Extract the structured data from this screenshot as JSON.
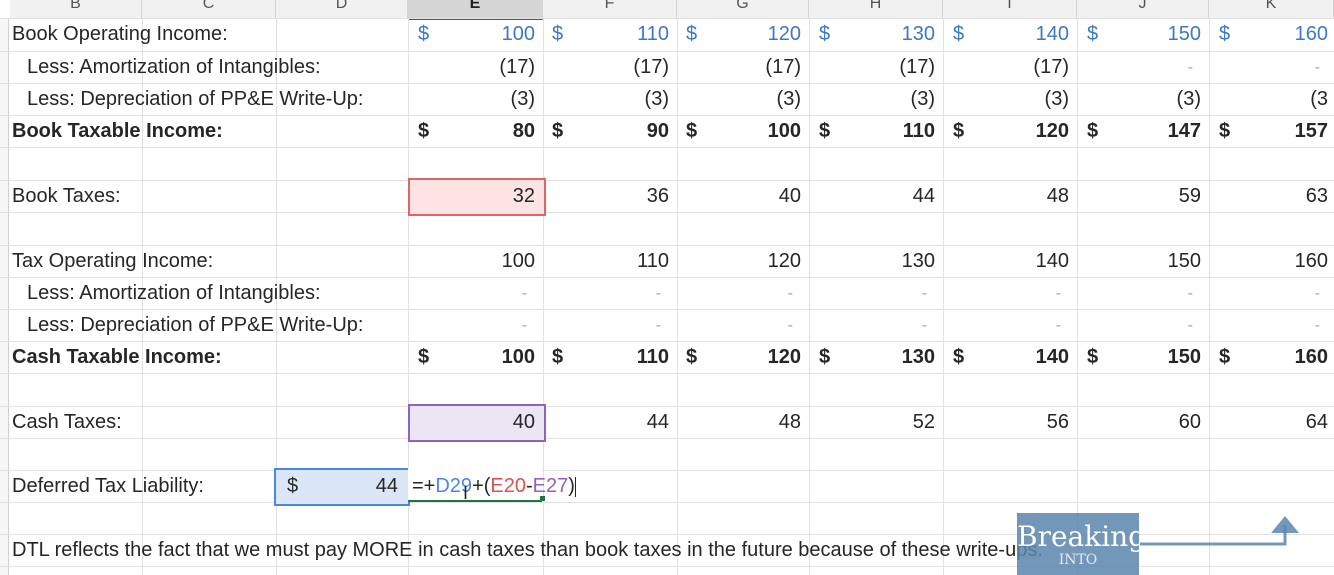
{
  "columns": [
    "B",
    "C",
    "D",
    "E",
    "F",
    "G",
    "H",
    "I",
    "J",
    "K"
  ],
  "selected_column": "E",
  "book_operating_income": {
    "label": "Book Operating Income:",
    "values": [
      "100",
      "110",
      "120",
      "130",
      "140",
      "150",
      "160"
    ]
  },
  "less_amort_1": {
    "label": "Less: Amortization of Intangibles:",
    "values": [
      "(17)",
      "(17)",
      "(17)",
      "(17)",
      "(17)",
      "-",
      "-"
    ]
  },
  "less_dep_1": {
    "label": "Less: Depreciation of PP&E Write-Up:",
    "values": [
      "(3)",
      "(3)",
      "(3)",
      "(3)",
      "(3)",
      "(3)",
      "(3"
    ]
  },
  "book_taxable_income": {
    "label": "Book Taxable Income:",
    "values": [
      "80",
      "90",
      "100",
      "110",
      "120",
      "147",
      "157"
    ]
  },
  "book_taxes": {
    "label": "Book Taxes:",
    "values": [
      "32",
      "36",
      "40",
      "44",
      "48",
      "59",
      "63"
    ]
  },
  "tax_operating_income": {
    "label": "Tax Operating Income:",
    "values": [
      "100",
      "110",
      "120",
      "130",
      "140",
      "150",
      "160"
    ]
  },
  "less_amort_2": {
    "label": "Less: Amortization of Intangibles:",
    "values": [
      "-",
      "-",
      "-",
      "-",
      "-",
      "-",
      "-"
    ]
  },
  "less_dep_2": {
    "label": "Less: Depreciation of PP&E Write-Up:",
    "values": [
      "-",
      "-",
      "-",
      "-",
      "-",
      "-",
      "-"
    ]
  },
  "cash_taxable_income": {
    "label": "Cash Taxable Income:",
    "values": [
      "100",
      "110",
      "120",
      "130",
      "140",
      "150",
      "160"
    ]
  },
  "cash_taxes": {
    "label": "Cash Taxes:",
    "values": [
      "40",
      "44",
      "48",
      "52",
      "56",
      "60",
      "64"
    ]
  },
  "deferred_tax": {
    "label": "Deferred Tax Liability:",
    "d_currency": "$",
    "d_value": "44",
    "formula_prefix": "=+",
    "formula_ref1": "D29",
    "formula_mid": "+(",
    "formula_ref2": "E20",
    "formula_minus": "-",
    "formula_ref3": "E27",
    "formula_close": ")"
  },
  "currency_symbol": "$",
  "note": "DTL reflects the fact that we must pay MORE in cash taxes than book taxes in the future because of these write-ups.",
  "logo_text": "Breaking",
  "logo_subtext": "INTO",
  "colors": {
    "blue_input": "#3c78c4",
    "book_tax_highlight": "#fce4e4",
    "book_tax_border": "#e06666",
    "cash_tax_highlight": "#ece6f4",
    "cash_tax_border": "#8e63c0",
    "ref_blue": "#4a86e8",
    "ref_red": "#d9534f",
    "active_green": "#217346"
  }
}
